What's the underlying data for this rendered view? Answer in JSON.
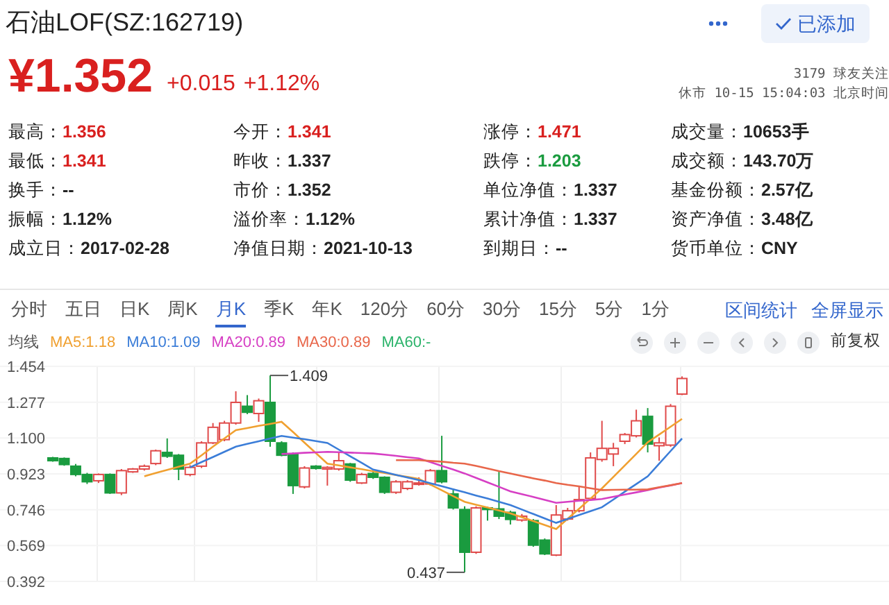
{
  "header": {
    "title": "石油LOF(SZ:162719)",
    "add_button": {
      "label": "已添加",
      "added": true
    },
    "price": "¥1.352",
    "change": "+0.015",
    "change_pct": "+1.12%",
    "followers": "3179 球友关注",
    "status": "休市 10-15 15:04:03 北京时间"
  },
  "stats": [
    [
      {
        "label": "最高：",
        "value": "1.356",
        "color": "#d9201f"
      },
      {
        "label": "今开：",
        "value": "1.341",
        "color": "#d9201f"
      },
      {
        "label": "涨停：",
        "value": "1.471",
        "color": "#d9201f"
      },
      {
        "label": "成交量：",
        "value": "10653手",
        "color": "#222222"
      }
    ],
    [
      {
        "label": "最低：",
        "value": "1.341",
        "color": "#d9201f"
      },
      {
        "label": "昨收：",
        "value": "1.337",
        "color": "#222222"
      },
      {
        "label": "跌停：",
        "value": "1.203",
        "color": "#1a9b3f"
      },
      {
        "label": "成交额：",
        "value": "143.70万",
        "color": "#222222"
      }
    ],
    [
      {
        "label": "换手：",
        "value": "--",
        "color": "#222222"
      },
      {
        "label": "市价：",
        "value": "1.352",
        "color": "#222222"
      },
      {
        "label": "单位净值：",
        "value": "1.337",
        "color": "#222222"
      },
      {
        "label": "基金份额：",
        "value": "2.57亿",
        "color": "#222222"
      }
    ],
    [
      {
        "label": "振幅：",
        "value": "1.12%",
        "color": "#222222"
      },
      {
        "label": "溢价率：",
        "value": "1.12%",
        "color": "#222222"
      },
      {
        "label": "累计净值：",
        "value": "1.337",
        "color": "#222222"
      },
      {
        "label": "资产净值：",
        "value": "3.48亿",
        "color": "#222222"
      }
    ],
    [
      {
        "label": "成立日：",
        "value": "2017-02-28",
        "color": "#222222"
      },
      {
        "label": "净值日期：",
        "value": "2021-10-13",
        "color": "#222222"
      },
      {
        "label": "到期日：",
        "value": "--",
        "color": "#222222"
      },
      {
        "label": "货币单位：",
        "value": "CNY",
        "color": "#222222"
      }
    ]
  ],
  "period_tabs": [
    {
      "label": "分时",
      "selected": false
    },
    {
      "label": "五日",
      "selected": false
    },
    {
      "label": "日K",
      "selected": false
    },
    {
      "label": "周K",
      "selected": false
    },
    {
      "label": "月K",
      "selected": true
    },
    {
      "label": "季K",
      "selected": false
    },
    {
      "label": "年K",
      "selected": false
    },
    {
      "label": "120分",
      "selected": false
    },
    {
      "label": "60分",
      "selected": false
    },
    {
      "label": "30分",
      "selected": false
    },
    {
      "label": "15分",
      "selected": false
    },
    {
      "label": "5分",
      "selected": false
    },
    {
      "label": "1分",
      "selected": false
    }
  ],
  "chart_links": [
    "区间统计",
    "全屏显示"
  ],
  "ma_legend": {
    "label": "均线",
    "extra": [
      {
        "text": "MA60:-",
        "color": "#2bb36a"
      }
    ]
  },
  "adjust_label": "前复权",
  "chart": {
    "chart_data": {
      "type": "candlestick",
      "grid": true,
      "ylim": [
        0.392,
        1.454
      ],
      "yticks": [
        {
          "value": 1.454,
          "label": "1.454"
        },
        {
          "value": 1.277,
          "label": "1.277"
        },
        {
          "value": 1.1,
          "label": "1.100"
        },
        {
          "value": 0.923,
          "label": "0.923"
        },
        {
          "value": 0.746,
          "label": "0.746"
        },
        {
          "value": 0.569,
          "label": "0.569"
        },
        {
          "value": 0.392,
          "label": "0.392"
        }
      ],
      "ohlc": [
        [
          1.002,
          1.007,
          0.983,
          0.988
        ],
        [
          0.999,
          1.004,
          0.963,
          0.969
        ],
        [
          0.961,
          0.972,
          0.911,
          0.92
        ],
        [
          0.92,
          0.928,
          0.873,
          0.884
        ],
        [
          0.889,
          0.925,
          0.878,
          0.92
        ],
        [
          0.92,
          0.925,
          0.824,
          0.829
        ],
        [
          0.829,
          0.947,
          0.818,
          0.939
        ],
        [
          0.933,
          0.952,
          0.928,
          0.947
        ],
        [
          0.947,
          0.969,
          0.939,
          0.961
        ],
        [
          0.974,
          1.043,
          0.966,
          1.037
        ],
        [
          1.029,
          1.098,
          1.002,
          1.01
        ],
        [
          1.015,
          1.021,
          0.892,
          0.947
        ],
        [
          0.92,
          0.966,
          0.911,
          0.955
        ],
        [
          0.961,
          1.084,
          0.952,
          1.076
        ],
        [
          1.076,
          1.174,
          1.07,
          1.153
        ],
        [
          1.092,
          1.185,
          1.084,
          1.174
        ],
        [
          1.174,
          1.331,
          1.166,
          1.276
        ],
        [
          1.257,
          1.312,
          1.218,
          1.227
        ],
        [
          1.221,
          1.295,
          1.18,
          1.284
        ],
        [
          1.276,
          1.409,
          1.057,
          1.084
        ],
        [
          1.076,
          1.084,
          1.01,
          1.015
        ],
        [
          1.021,
          1.029,
          0.824,
          0.865
        ],
        [
          0.859,
          0.961,
          0.851,
          0.952
        ],
        [
          0.961,
          0.966,
          0.944,
          0.95
        ],
        [
          0.947,
          0.961,
          0.865,
          0.955
        ],
        [
          0.947,
          1.029,
          0.939,
          0.988
        ],
        [
          0.972,
          0.977,
          0.884,
          0.892
        ],
        [
          0.878,
          0.928,
          0.873,
          0.92
        ],
        [
          0.925,
          0.933,
          0.898,
          0.906
        ],
        [
          0.906,
          0.911,
          0.824,
          0.832
        ],
        [
          0.832,
          0.892,
          0.824,
          0.884
        ],
        [
          0.851,
          0.892,
          0.843,
          0.884
        ],
        [
          0.873,
          0.906,
          0.865,
          0.878
        ],
        [
          0.873,
          0.947,
          0.865,
          0.939
        ],
        [
          0.939,
          1.111,
          0.876,
          0.884
        ],
        [
          0.824,
          0.851,
          0.747,
          0.755
        ],
        [
          0.747,
          0.763,
          0.437,
          0.536
        ],
        [
          0.536,
          0.763,
          0.528,
          0.755
        ],
        [
          0.755,
          0.761,
          0.692,
          0.747
        ],
        [
          0.75,
          0.933,
          0.7,
          0.714
        ],
        [
          0.733,
          0.741,
          0.673,
          0.698
        ],
        [
          0.695,
          0.725,
          0.687,
          0.714
        ],
        [
          0.692,
          0.7,
          0.563,
          0.571
        ],
        [
          0.596,
          0.604,
          0.522,
          0.528
        ],
        [
          0.522,
          0.769,
          0.517,
          0.72
        ],
        [
          0.7,
          0.755,
          0.692,
          0.741
        ],
        [
          0.741,
          0.865,
          0.733,
          0.796
        ],
        [
          0.802,
          1.029,
          0.791,
          1.002
        ],
        [
          0.994,
          1.185,
          0.983,
          1.049
        ],
        [
          1.021,
          1.076,
          0.961,
          1.049
        ],
        [
          1.084,
          1.125,
          1.07,
          1.117
        ],
        [
          1.111,
          1.24,
          1.103,
          1.185
        ],
        [
          1.207,
          1.248,
          1.029,
          1.07
        ],
        [
          1.062,
          1.103,
          0.988,
          1.076
        ],
        [
          1.065,
          1.268,
          1.057,
          1.257
        ],
        [
          1.317,
          1.404,
          1.312,
          1.394
        ]
      ],
      "series": [
        {
          "name": "MA5:1.18",
          "type": "line",
          "color": "#f0a030",
          "values": [
            null,
            null,
            null,
            null,
            null,
            null,
            null,
            null,
            0.911,
            0.927,
            0.943,
            0.958,
            0.974,
            1.015,
            1.057,
            1.098,
            1.139,
            1.149,
            1.16,
            1.17,
            1.18,
            1.129,
            1.077,
            1.026,
            0.974,
            0.965,
            0.955,
            0.946,
            0.936,
            0.927,
            0.917,
            0.908,
            0.898,
            0.87,
            0.842,
            0.813,
            0.785,
            0.771,
            0.757,
            0.742,
            0.728,
            0.709,
            0.69,
            0.67,
            0.651,
            0.701,
            0.751,
            0.801,
            0.851,
            0.908,
            0.965,
            1.022,
            1.079,
            1.117,
            1.156,
            1.194
          ]
        },
        {
          "name": "MA10:1.09",
          "type": "line",
          "color": "#3b7dd8",
          "values": [
            null,
            null,
            null,
            null,
            null,
            null,
            null,
            null,
            null,
            null,
            null,
            null,
            0.955,
            0.981,
            1.006,
            1.032,
            1.057,
            1.071,
            1.084,
            1.098,
            1.111,
            1.102,
            1.094,
            1.085,
            1.076,
            1.043,
            1.01,
            0.977,
            0.944,
            0.931,
            0.918,
            0.905,
            0.892,
            0.877,
            0.862,
            0.847,
            0.832,
            0.816,
            0.801,
            0.785,
            0.769,
            0.747,
            0.725,
            0.703,
            0.681,
            0.7,
            0.72,
            0.739,
            0.758,
            0.796,
            0.835,
            0.873,
            0.911,
            0.973,
            1.036,
            1.098
          ]
        },
        {
          "name": "MA20:0.89",
          "type": "line",
          "color": "#d63fc4",
          "values": [
            null,
            null,
            null,
            null,
            null,
            null,
            null,
            null,
            null,
            null,
            null,
            null,
            null,
            null,
            null,
            null,
            null,
            null,
            null,
            null,
            1.021,
            1.024,
            1.027,
            1.029,
            1.032,
            1.03,
            1.028,
            1.026,
            1.024,
            1.018,
            1.012,
            1.005,
            0.999,
            0.981,
            0.962,
            0.944,
            0.925,
            0.903,
            0.881,
            0.859,
            0.837,
            0.823,
            0.809,
            0.794,
            0.78,
            0.785,
            0.79,
            0.794,
            0.799,
            0.81,
            0.821,
            0.832,
            0.843,
            0.855,
            0.866,
            0.878
          ]
        },
        {
          "name": "MA30:0.89",
          "type": "line",
          "color": "#e8664a",
          "values": [
            null,
            null,
            null,
            null,
            null,
            null,
            null,
            null,
            null,
            null,
            null,
            null,
            null,
            null,
            null,
            null,
            null,
            null,
            null,
            null,
            null,
            null,
            null,
            null,
            null,
            null,
            null,
            null,
            null,
            null,
            0.991,
            0.991,
            0.991,
            0.987,
            0.983,
            0.978,
            0.974,
            0.962,
            0.95,
            0.937,
            0.925,
            0.913,
            0.901,
            0.89,
            0.878,
            0.869,
            0.861,
            0.852,
            0.843,
            0.844,
            0.845,
            0.845,
            0.846,
            0.857,
            0.867,
            0.878
          ]
        }
      ],
      "annotations": [
        "1.409",
        "0.437"
      ]
    }
  }
}
